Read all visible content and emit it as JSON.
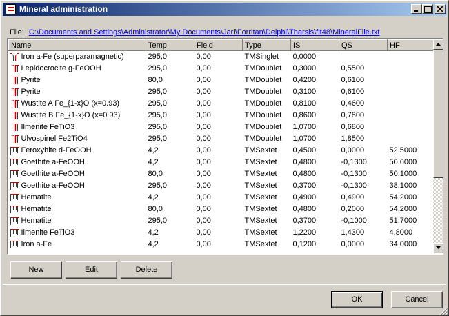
{
  "window": {
    "title": "Mineral administration"
  },
  "file": {
    "label": "File:",
    "path": "C:\\Documents and Settings\\Administrator\\My Documents\\Jari\\Forritan\\Delphi\\Tharsis\\fit48\\MineralFile.txt"
  },
  "grid": {
    "columns": [
      "Name",
      "Temp",
      "Field",
      "Type",
      "IS",
      "QS",
      "HF"
    ],
    "rows": [
      {
        "icon": "singlet",
        "name": "Iron a-Fe (superparamagnetic)",
        "temp": "295,0",
        "field": "0,00",
        "type": "TMSinglet",
        "is": "0,0000",
        "qs": "",
        "hf": ""
      },
      {
        "icon": "doublet",
        "name": "Lepidocrocite g-FeOOH",
        "temp": "295,0",
        "field": "0,00",
        "type": "TMDoublet",
        "is": "0,3000",
        "qs": "0,5500",
        "hf": ""
      },
      {
        "icon": "doublet",
        "name": "Pyrite",
        "temp": "80,0",
        "field": "0,00",
        "type": "TMDoublet",
        "is": "0,4200",
        "qs": "0,6100",
        "hf": ""
      },
      {
        "icon": "doublet",
        "name": "Pyrite",
        "temp": "295,0",
        "field": "0,00",
        "type": "TMDoublet",
        "is": "0,3100",
        "qs": "0,6100",
        "hf": ""
      },
      {
        "icon": "doublet",
        "name": "Wustite A Fe_{1-x}O (x=0.93)",
        "temp": "295,0",
        "field": "0,00",
        "type": "TMDoublet",
        "is": "0,8100",
        "qs": "0,4600",
        "hf": ""
      },
      {
        "icon": "doublet",
        "name": "Wustite B Fe_{1-x}O (x=0.93)",
        "temp": "295,0",
        "field": "0,00",
        "type": "TMDoublet",
        "is": "0,8600",
        "qs": "0,7800",
        "hf": ""
      },
      {
        "icon": "doublet",
        "name": "Ilmenite FeTiO3",
        "temp": "295,0",
        "field": "0,00",
        "type": "TMDoublet",
        "is": "1,0700",
        "qs": "0,6800",
        "hf": ""
      },
      {
        "icon": "doublet",
        "name": "Ulvospinel Fe2TiO4",
        "temp": "295,0",
        "field": "0,00",
        "type": "TMDoublet",
        "is": "1,0700",
        "qs": "1,8500",
        "hf": ""
      },
      {
        "icon": "sextet",
        "name": "Feroxyhite  d-FeOOH",
        "temp": "4,2",
        "field": "0,00",
        "type": "TMSextet",
        "is": "0,4500",
        "qs": "0,0000",
        "hf": "52,5000"
      },
      {
        "icon": "sextet",
        "name": "Goethite a-FeOOH",
        "temp": "4,2",
        "field": "0,00",
        "type": "TMSextet",
        "is": "0,4800",
        "qs": "-0,1300",
        "hf": "50,6000"
      },
      {
        "icon": "sextet",
        "name": "Goethite a-FeOOH",
        "temp": "80,0",
        "field": "0,00",
        "type": "TMSextet",
        "is": "0,4800",
        "qs": "-0,1300",
        "hf": "50,1000"
      },
      {
        "icon": "sextet",
        "name": "Goethite a-FeOOH",
        "temp": "295,0",
        "field": "0,00",
        "type": "TMSextet",
        "is": "0,3700",
        "qs": "-0,1300",
        "hf": "38,1000"
      },
      {
        "icon": "sextet",
        "name": "Hematite",
        "temp": "4,2",
        "field": "0,00",
        "type": "TMSextet",
        "is": "0,4900",
        "qs": "0,4900",
        "hf": "54,2000"
      },
      {
        "icon": "sextet",
        "name": "Hematite",
        "temp": "80,0",
        "field": "0,00",
        "type": "TMSextet",
        "is": "0,4800",
        "qs": "0,2000",
        "hf": "54,2000"
      },
      {
        "icon": "sextet",
        "name": "Hematite",
        "temp": "295,0",
        "field": "0,00",
        "type": "TMSextet",
        "is": "0,3700",
        "qs": "-0,1000",
        "hf": "51,7000"
      },
      {
        "icon": "sextet",
        "name": "Ilmenite FeTiO3",
        "temp": "4,2",
        "field": "0,00",
        "type": "TMSextet",
        "is": "1,2200",
        "qs": "1,4300",
        "hf": "4,8000"
      },
      {
        "icon": "sextet",
        "name": "Iron a-Fe",
        "temp": "4,2",
        "field": "0,00",
        "type": "TMSextet",
        "is": "0,1200",
        "qs": "0,0000",
        "hf": "34,0000"
      }
    ]
  },
  "buttons": {
    "new": "New",
    "edit": "Edit",
    "delete": "Delete",
    "ok": "OK",
    "cancel": "Cancel"
  },
  "colors": {
    "icon_red": "#c00000",
    "link": "#0000ee",
    "title_start": "#0a246a",
    "title_end": "#a6caf0"
  }
}
